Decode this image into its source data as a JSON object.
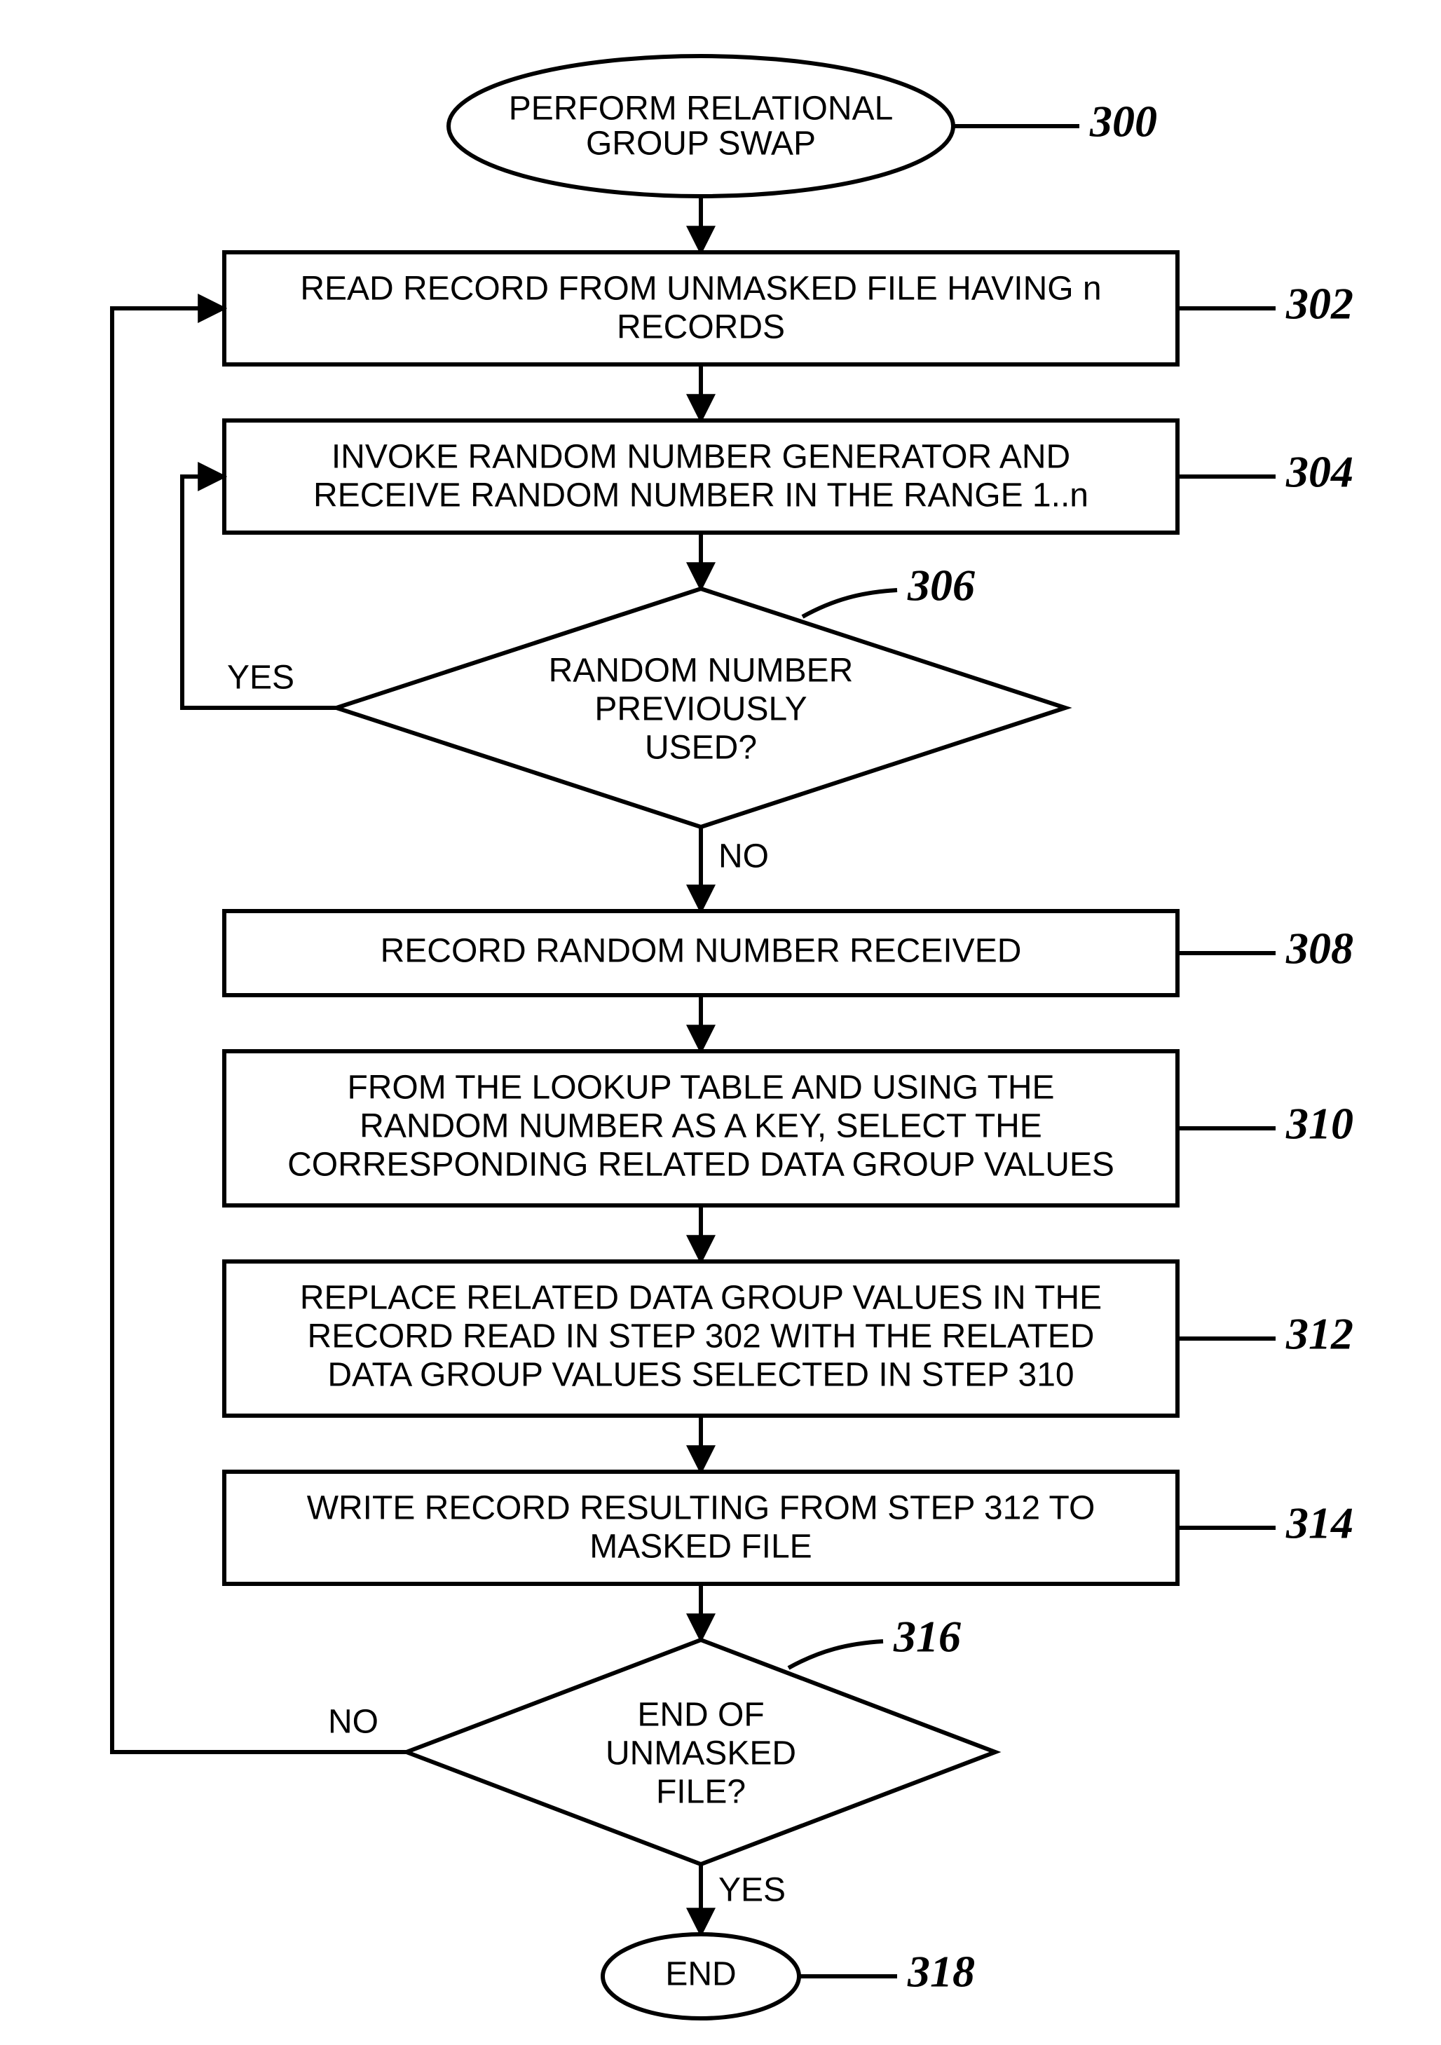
{
  "chart_data": {
    "type": "flowchart",
    "nodes": [
      {
        "id": "300",
        "shape": "terminator",
        "text": [
          "PERFORM RELATIONAL",
          "GROUP SWAP"
        ]
      },
      {
        "id": "302",
        "shape": "process",
        "text": [
          "READ RECORD FROM UNMASKED FILE HAVING n",
          "RECORDS"
        ]
      },
      {
        "id": "304",
        "shape": "process",
        "text": [
          "INVOKE RANDOM NUMBER GENERATOR AND",
          "RECEIVE RANDOM NUMBER IN THE RANGE 1..n"
        ]
      },
      {
        "id": "306",
        "shape": "decision",
        "text": [
          "RANDOM NUMBER",
          "PREVIOUSLY",
          "USED?"
        ]
      },
      {
        "id": "308",
        "shape": "process",
        "text": [
          "RECORD RANDOM NUMBER RECEIVED"
        ]
      },
      {
        "id": "310",
        "shape": "process",
        "text": [
          "FROM THE LOOKUP TABLE AND USING THE",
          "RANDOM NUMBER AS A KEY, SELECT THE",
          "CORRESPONDING RELATED DATA GROUP VALUES"
        ]
      },
      {
        "id": "312",
        "shape": "process",
        "text": [
          "REPLACE RELATED DATA GROUP VALUES IN THE",
          "RECORD READ IN STEP 302 WITH THE RELATED",
          "DATA GROUP VALUES SELECTED IN STEP 310"
        ]
      },
      {
        "id": "314",
        "shape": "process",
        "text": [
          "WRITE RECORD RESULTING FROM STEP 312 TO",
          "MASKED FILE"
        ]
      },
      {
        "id": "316",
        "shape": "decision",
        "text": [
          "END OF",
          "UNMASKED",
          "FILE?"
        ]
      },
      {
        "id": "318",
        "shape": "terminator",
        "text": [
          "END"
        ]
      }
    ],
    "edges": [
      {
        "from": "300",
        "to": "302"
      },
      {
        "from": "302",
        "to": "304"
      },
      {
        "from": "304",
        "to": "306"
      },
      {
        "from": "306",
        "to": "304",
        "label": "YES"
      },
      {
        "from": "306",
        "to": "308",
        "label": "NO"
      },
      {
        "from": "308",
        "to": "310"
      },
      {
        "from": "310",
        "to": "312"
      },
      {
        "from": "312",
        "to": "314"
      },
      {
        "from": "314",
        "to": "316"
      },
      {
        "from": "316",
        "to": "302",
        "label": "NO"
      },
      {
        "from": "316",
        "to": "318",
        "label": "YES"
      }
    ]
  },
  "labels": {
    "n300_l1": "PERFORM RELATIONAL",
    "n300_l2": "GROUP SWAP",
    "n302_l1": "READ RECORD FROM UNMASKED FILE HAVING n",
    "n302_l2": "RECORDS",
    "n304_l1": "INVOKE RANDOM NUMBER GENERATOR AND",
    "n304_l2": "RECEIVE RANDOM NUMBER IN THE RANGE 1..n",
    "n306_l1": "RANDOM NUMBER",
    "n306_l2": "PREVIOUSLY",
    "n306_l3": "USED?",
    "n308_l1": "RECORD RANDOM NUMBER RECEIVED",
    "n310_l1": "FROM THE LOOKUP TABLE AND USING THE",
    "n310_l2": "RANDOM NUMBER AS A KEY, SELECT THE",
    "n310_l3": "CORRESPONDING RELATED DATA GROUP VALUES",
    "n312_l1": "REPLACE RELATED DATA GROUP VALUES IN THE",
    "n312_l2": "RECORD READ IN STEP 302 WITH THE RELATED",
    "n312_l3": "DATA GROUP VALUES SELECTED IN STEP 310",
    "n314_l1": "WRITE RECORD RESULTING FROM STEP 312 TO",
    "n314_l2": "MASKED FILE",
    "n316_l1": "END OF",
    "n316_l2": "UNMASKED",
    "n316_l3": "FILE?",
    "n318_l1": "END",
    "ref300": "300",
    "ref302": "302",
    "ref304": "304",
    "ref306": "306",
    "ref308": "308",
    "ref310": "310",
    "ref312": "312",
    "ref314": "314",
    "ref316": "316",
    "ref318": "318",
    "yes306": "YES",
    "no306": "NO",
    "no316": "NO",
    "yes316": "YES"
  }
}
